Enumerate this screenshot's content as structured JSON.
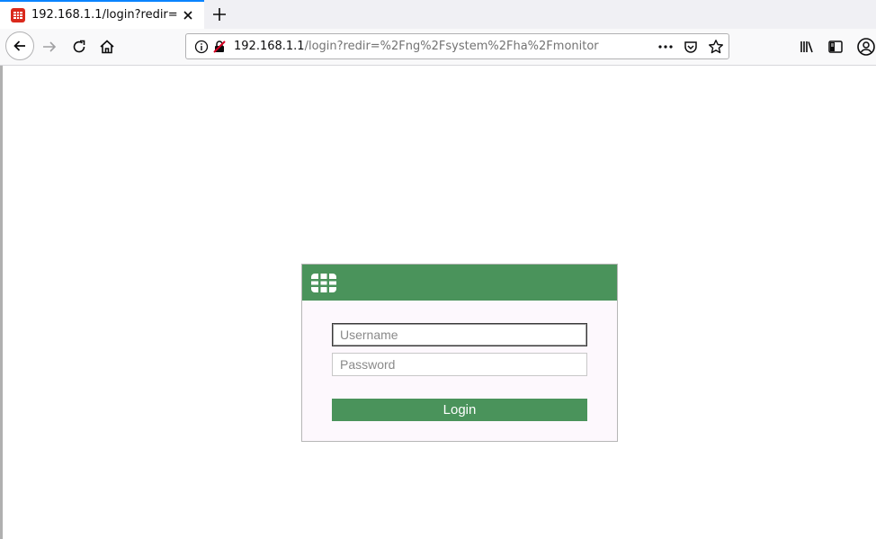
{
  "browser": {
    "tab": {
      "title": "192.168.1.1/login?redir=%2Fng%2Fsystem%2Fha%2Fmonitor",
      "favicon": "fortinet-icon",
      "favicon_color": "#da291c"
    },
    "url": {
      "host": "192.168.1.1",
      "path": "/login?redir=%2Fng%2Fsystem%2Fha%2Fmonitor"
    },
    "toolbar_icons": [
      "back-icon",
      "forward-icon",
      "reload-icon",
      "home-icon",
      "info-icon",
      "insecure-lock-icon",
      "more-icon",
      "pocket-icon",
      "star-icon",
      "library-icon",
      "sidebar-icon",
      "account-icon"
    ]
  },
  "login": {
    "header_color": "#4a935b",
    "logo": "fortinet-logo-icon",
    "username_placeholder": "Username",
    "password_placeholder": "Password",
    "login_label": "Login"
  }
}
